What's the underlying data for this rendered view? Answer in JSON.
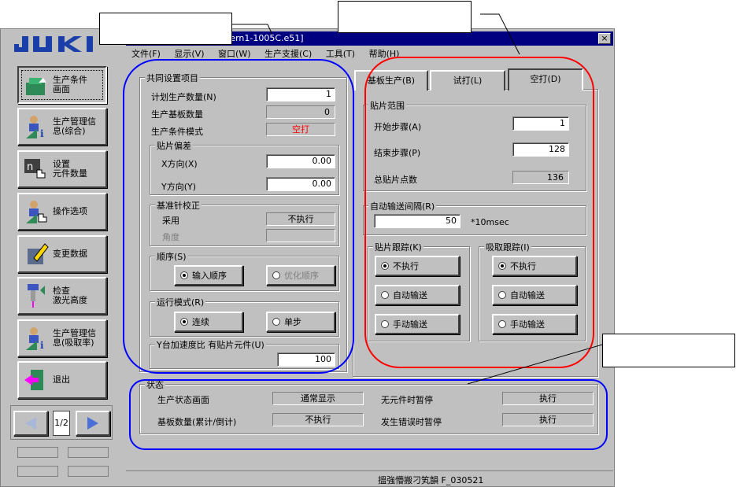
{
  "window": {
    "title_fragment": "tern1-1005C.e51]",
    "close_label": "×"
  },
  "menu": [
    {
      "label": "文件(F)"
    },
    {
      "label": "显示(V)"
    },
    {
      "label": "窗口(W)"
    },
    {
      "label": "生产支援(C)"
    },
    {
      "label": "工具(T)"
    },
    {
      "label": "帮助(H)"
    }
  ],
  "sidebar": {
    "logo": "JUKI",
    "items": [
      {
        "label": "生产条件\n画面",
        "icon": "production-condition-icon"
      },
      {
        "label": "生产管理信\n息(综合)",
        "icon": "production-info-icon"
      },
      {
        "label": "设置\n元件数量",
        "icon": "component-count-icon"
      },
      {
        "label": "操作选项",
        "icon": "operation-option-icon"
      },
      {
        "label": "变更数据",
        "icon": "edit-data-icon"
      },
      {
        "label": "检查\n激光高度",
        "icon": "laser-height-icon"
      },
      {
        "label": "生产管理信\n息(吸取率)",
        "icon": "pickup-rate-icon"
      },
      {
        "label": "退出",
        "icon": "exit-icon"
      }
    ],
    "page_indicator": "1/2"
  },
  "common": {
    "title": "共同设置项目",
    "plan_qty_label": "计划生产数量(N)",
    "plan_qty_value": "1",
    "produced_label": "生产基板数量",
    "produced_value": "0",
    "mode_label": "生产条件模式",
    "mode_value": "空打",
    "offset_title": "贴片偏差",
    "x_label": "X方向(X)",
    "x_value": "0.00",
    "y_label": "Y方向(Y)",
    "y_value": "0.00",
    "ref_title": "基准针校正",
    "adopt_label": "采用",
    "adopt_value": "不执行",
    "angle_label": "角度",
    "order_title": "顺序(S)",
    "order_opt1": "输入顺序",
    "order_opt2": "优化顺序",
    "run_title": "运行模式(R)",
    "run_opt1": "连续",
    "run_opt2": "单步",
    "accel_title": "Y台加速度比 有贴片元件(U)",
    "accel_value": "100"
  },
  "tabs": [
    {
      "label": "基板生产(B)"
    },
    {
      "label": "试打(L)"
    },
    {
      "label": "空打(D)"
    }
  ],
  "placement": {
    "title": "贴片范围",
    "start_label": "开始步骤(A)",
    "start_value": "1",
    "end_label": "结束步骤(P)",
    "end_value": "128",
    "total_label": "总贴片点数",
    "total_value": "136",
    "interval_title": "自动输送间隔(R)",
    "interval_value": "50",
    "interval_unit": "*10msec",
    "track_title": "贴片跟踪(K)",
    "pick_title": "吸取跟踪(I)",
    "opt_none": "不执行",
    "opt_auto": "自动输送",
    "opt_manual": "手动输送"
  },
  "status": {
    "title": "状态",
    "screen_label": "生产状态画面",
    "screen_value": "通常显示",
    "count_label": "基板数量(累计/倒计)",
    "count_value": "不执行",
    "nocomp_label": "无元件时暂停",
    "nocomp_value": "执行",
    "error_label": "发生错误时暂停",
    "error_value": "执行"
  },
  "statusbar": {
    "text": "搵強懵搬刁笂韻  F_030521"
  },
  "colors": {
    "blue_outline": "#0000ff",
    "red_outline": "#ff0000",
    "title_bar": "#000080"
  }
}
